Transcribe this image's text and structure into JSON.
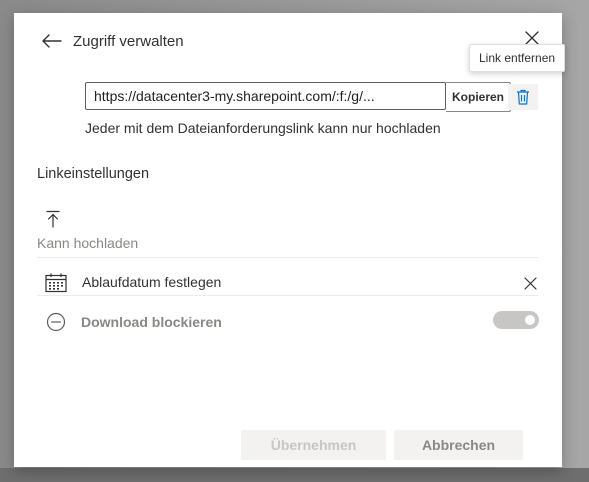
{
  "dialog": {
    "title": "Zugriff verwalten",
    "tooltip": "Link entfernen",
    "link": {
      "url": "https://datacenter3-my.sharepoint.com/:f:/g/...",
      "copy_label": "Kopieren",
      "description": "Jeder mit dem Dateianforderungslink kann nur hochladen"
    },
    "settings": {
      "section_title": "Linkeinstellungen",
      "permission": "Kann hochladen",
      "expiry_label": "Ablaufdatum festlegen",
      "block_download_label": "Download blockieren",
      "block_download_enabled": false
    },
    "footer": {
      "apply_label": "Übernehmen",
      "cancel_label": "Abbrechen"
    },
    "colors": {
      "accent": "#0078d4",
      "disabled_text": "#8a8886"
    },
    "icons": {
      "back": "arrow-left-icon",
      "close": "close-icon",
      "delete": "trash-icon",
      "upload": "upload-icon",
      "calendar": "calendar-icon",
      "block": "block-icon",
      "clear": "close-icon"
    }
  }
}
